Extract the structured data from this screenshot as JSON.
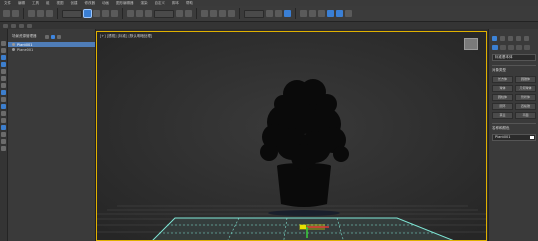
{
  "menu": {
    "items": [
      "文件",
      "编辑",
      "工具",
      "组",
      "视图",
      "创建",
      "修改器",
      "动画",
      "图形编辑器",
      "渲染",
      "自定义",
      "脚本",
      "帮助"
    ]
  },
  "explorer": {
    "title": "场景资源管理器",
    "items": [
      {
        "label": "Plant001",
        "selected": true
      },
      {
        "label": "Plane001",
        "selected": false
      }
    ]
  },
  "viewport": {
    "label": "[+] [透视] [标准] [默认明暗处理]"
  },
  "command_panel": {
    "dropdown": "标准基本体",
    "rollout1": "对象类型",
    "buttons": [
      "长方体",
      "圆锥体",
      "球体",
      "几何球体",
      "圆柱体",
      "管状体",
      "圆环",
      "四棱锥",
      "茶壶",
      "平面"
    ],
    "rollout2": "名称和颜色",
    "name_value": "Plant001"
  },
  "colors": {
    "viewport_border": "#e0b100",
    "selection": "#4f7db8",
    "accent_blue": "#3a7fd5",
    "grid_cyan": "#7fe7d6"
  }
}
